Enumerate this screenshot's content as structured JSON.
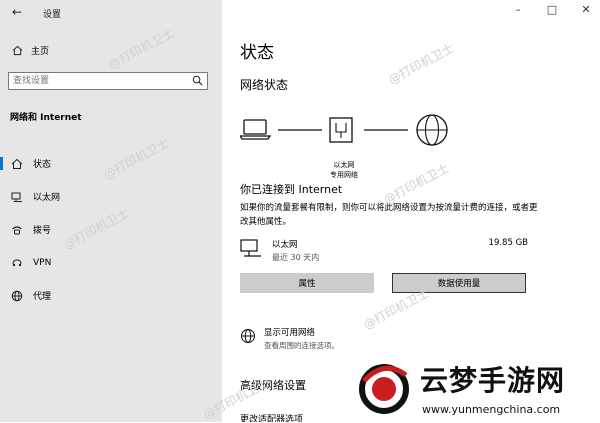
{
  "window": {
    "title": "设置"
  },
  "sidebar": {
    "home_label": "主页",
    "search_placeholder": "查找设置",
    "section_title": "网络和 Internet",
    "items": [
      {
        "label": "状态",
        "icon": "home-network-icon",
        "active": true
      },
      {
        "label": "以太网",
        "icon": "ethernet-monitor-icon"
      },
      {
        "label": "拨号",
        "icon": "dialup-phone-icon"
      },
      {
        "label": "VPN",
        "icon": "vpn-icon"
      },
      {
        "label": "代理",
        "icon": "globe-icon"
      }
    ]
  },
  "main": {
    "page_title": "状态",
    "network_status_title": "网络状态",
    "diagram_label": "以太网\n专用网络",
    "connected_text": "你已连接到 Internet",
    "description": "如果你的流量套餐有限制，则你可以将此网络设置为按流量计费的连接，或者更改其他属性。",
    "adapter": {
      "name": "以太网",
      "period": "最近 30 天内",
      "usage": "19.85 GB"
    },
    "buttons": {
      "properties": "属性",
      "data_usage": "数据使用量"
    },
    "show_networks": {
      "title": "显示可用网络",
      "subtitle": "查看周围的连接选项。"
    },
    "advanced_title": "高级网络设置",
    "cut_item": "更改适配器选项"
  },
  "watermark": {
    "text": "@打印机卫士"
  },
  "brand": {
    "name": "云梦手游网",
    "url": "www.yunmengchina.com"
  },
  "colors": {
    "accent": "#0078d4",
    "brand_red": "#c81e1e",
    "sidebar_bg": "#e6e6e6"
  }
}
